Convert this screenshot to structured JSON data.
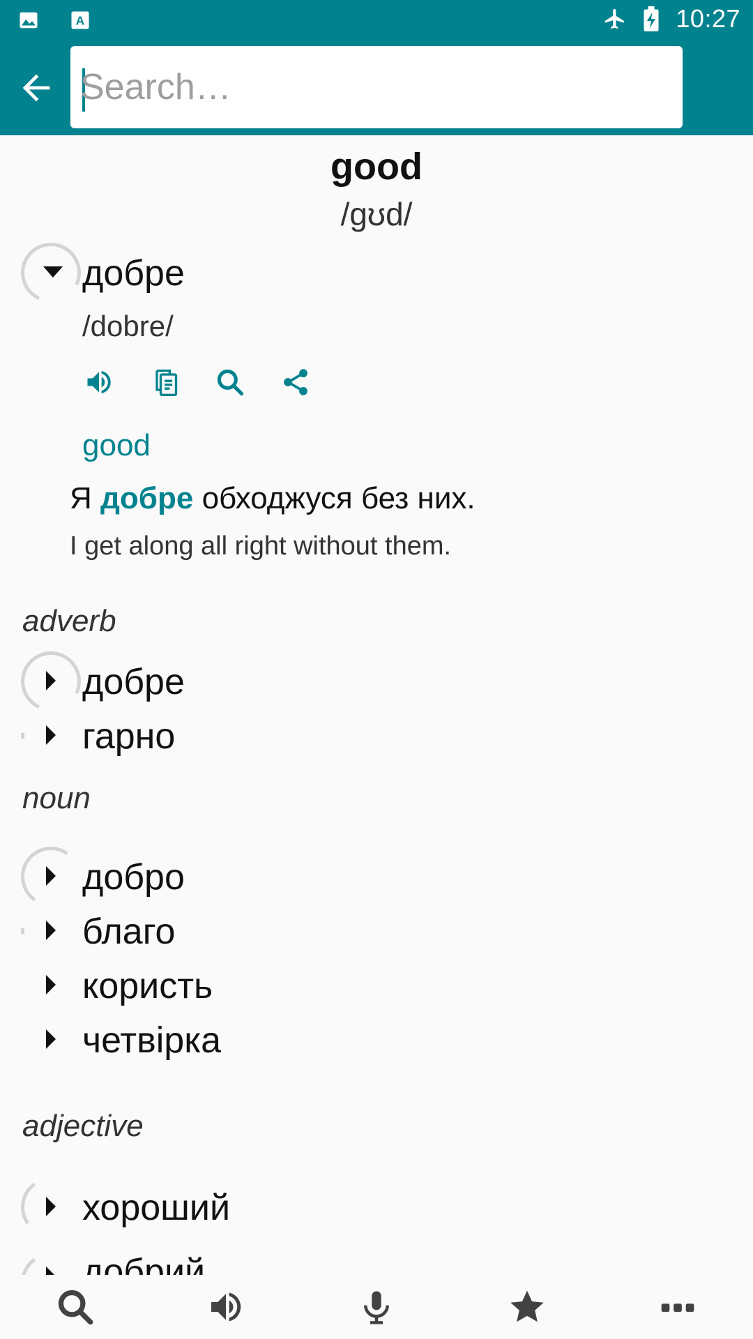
{
  "status_bar": {
    "time": "10:27",
    "left_icons": [
      "image-icon",
      "text-format-icon"
    ],
    "right_icons": [
      "airplane-icon",
      "battery-charging-icon"
    ]
  },
  "toolbar": {
    "back_icon": "arrow-back-icon",
    "search": {
      "placeholder": "Search…",
      "value": ""
    }
  },
  "entry": {
    "word": "good",
    "phonetic": "/gʊd/",
    "top_sense": {
      "word": "добре",
      "phonetic": "/dobre/",
      "actions": [
        "speaker-icon",
        "copy-icon",
        "search-icon",
        "share-icon"
      ],
      "back_translation": "good",
      "example": {
        "before": "Я ",
        "highlight": "добре",
        "after": " обходжуся без них.",
        "translation": "I get along all right without them."
      }
    },
    "groups": [
      {
        "pos": "adverb",
        "items": [
          "добре",
          "гарно"
        ]
      },
      {
        "pos": "noun",
        "items": [
          "добро",
          "благо",
          "користь",
          "четвірка"
        ]
      },
      {
        "pos": "adjective",
        "items": [
          "хороший",
          "добрий"
        ]
      }
    ]
  },
  "bottom_nav": {
    "items": [
      "search-icon",
      "speaker-icon",
      "microphone-icon",
      "star-icon",
      "more-icon"
    ]
  },
  "colors": {
    "accent": "#00838f",
    "background": "#fafafa"
  }
}
